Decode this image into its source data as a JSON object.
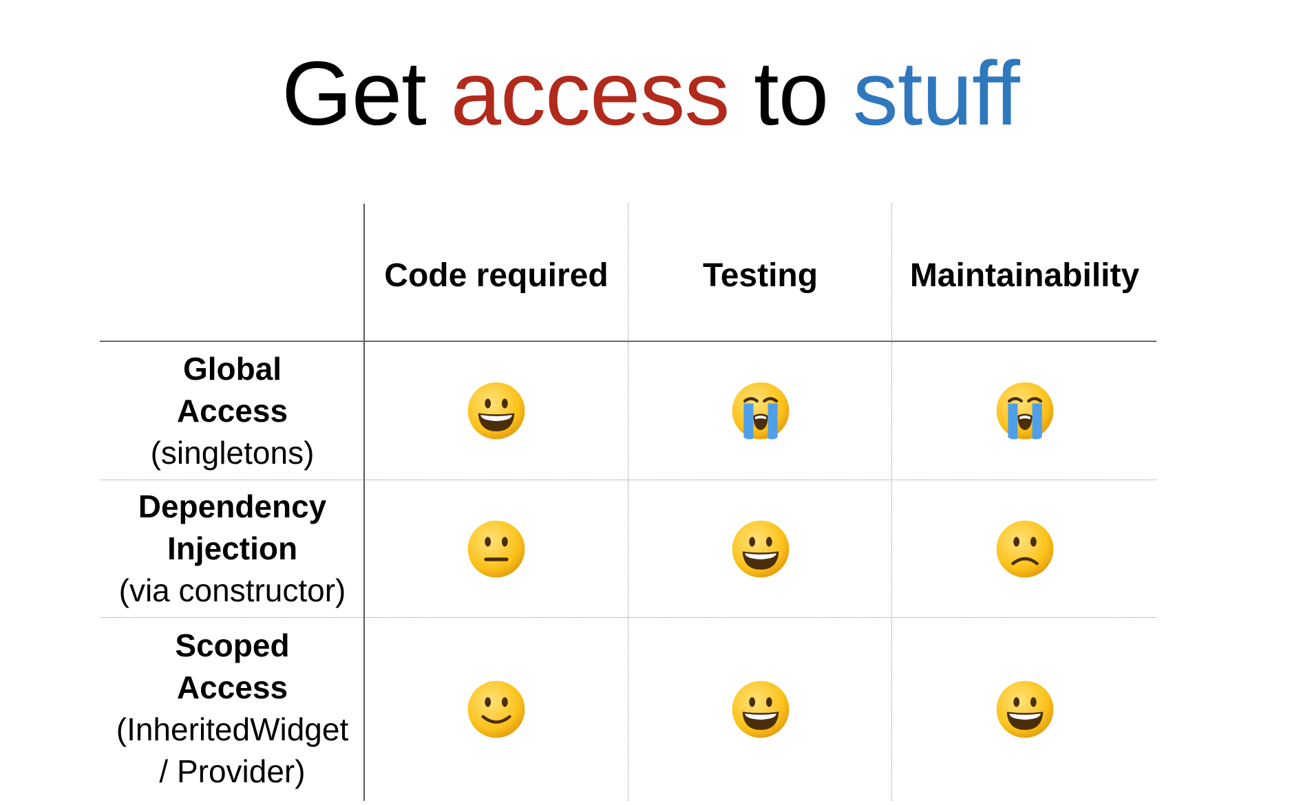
{
  "title": {
    "part1": "Get ",
    "part2": "access",
    "part3": " to ",
    "part4": "stuff",
    "color_access": "#b12a1b",
    "color_stuff": "#2f78bd"
  },
  "table": {
    "columns": [
      "Code required",
      "Testing",
      "Maintainability"
    ],
    "rows": [
      {
        "name_line1": "Global",
        "name_line2": "Access",
        "sub_line1": "(singletons)",
        "sub_line2": "",
        "cells": [
          "grinning-face-icon",
          "loudly-crying-face-icon",
          "loudly-crying-face-icon"
        ]
      },
      {
        "name_line1": "Dependency",
        "name_line2": "Injection",
        "sub_line1": "(via constructor)",
        "sub_line2": "",
        "cells": [
          "neutral-face-icon",
          "grinning-face-icon",
          "slightly-frowning-face-icon"
        ]
      },
      {
        "name_line1": "Scoped",
        "name_line2": "Access",
        "sub_line1": "(InheritedWidget",
        "sub_line2": "/ Provider)",
        "cells": [
          "slightly-smiling-face-icon",
          "grinning-face-icon",
          "grinning-face-icon"
        ]
      }
    ]
  }
}
